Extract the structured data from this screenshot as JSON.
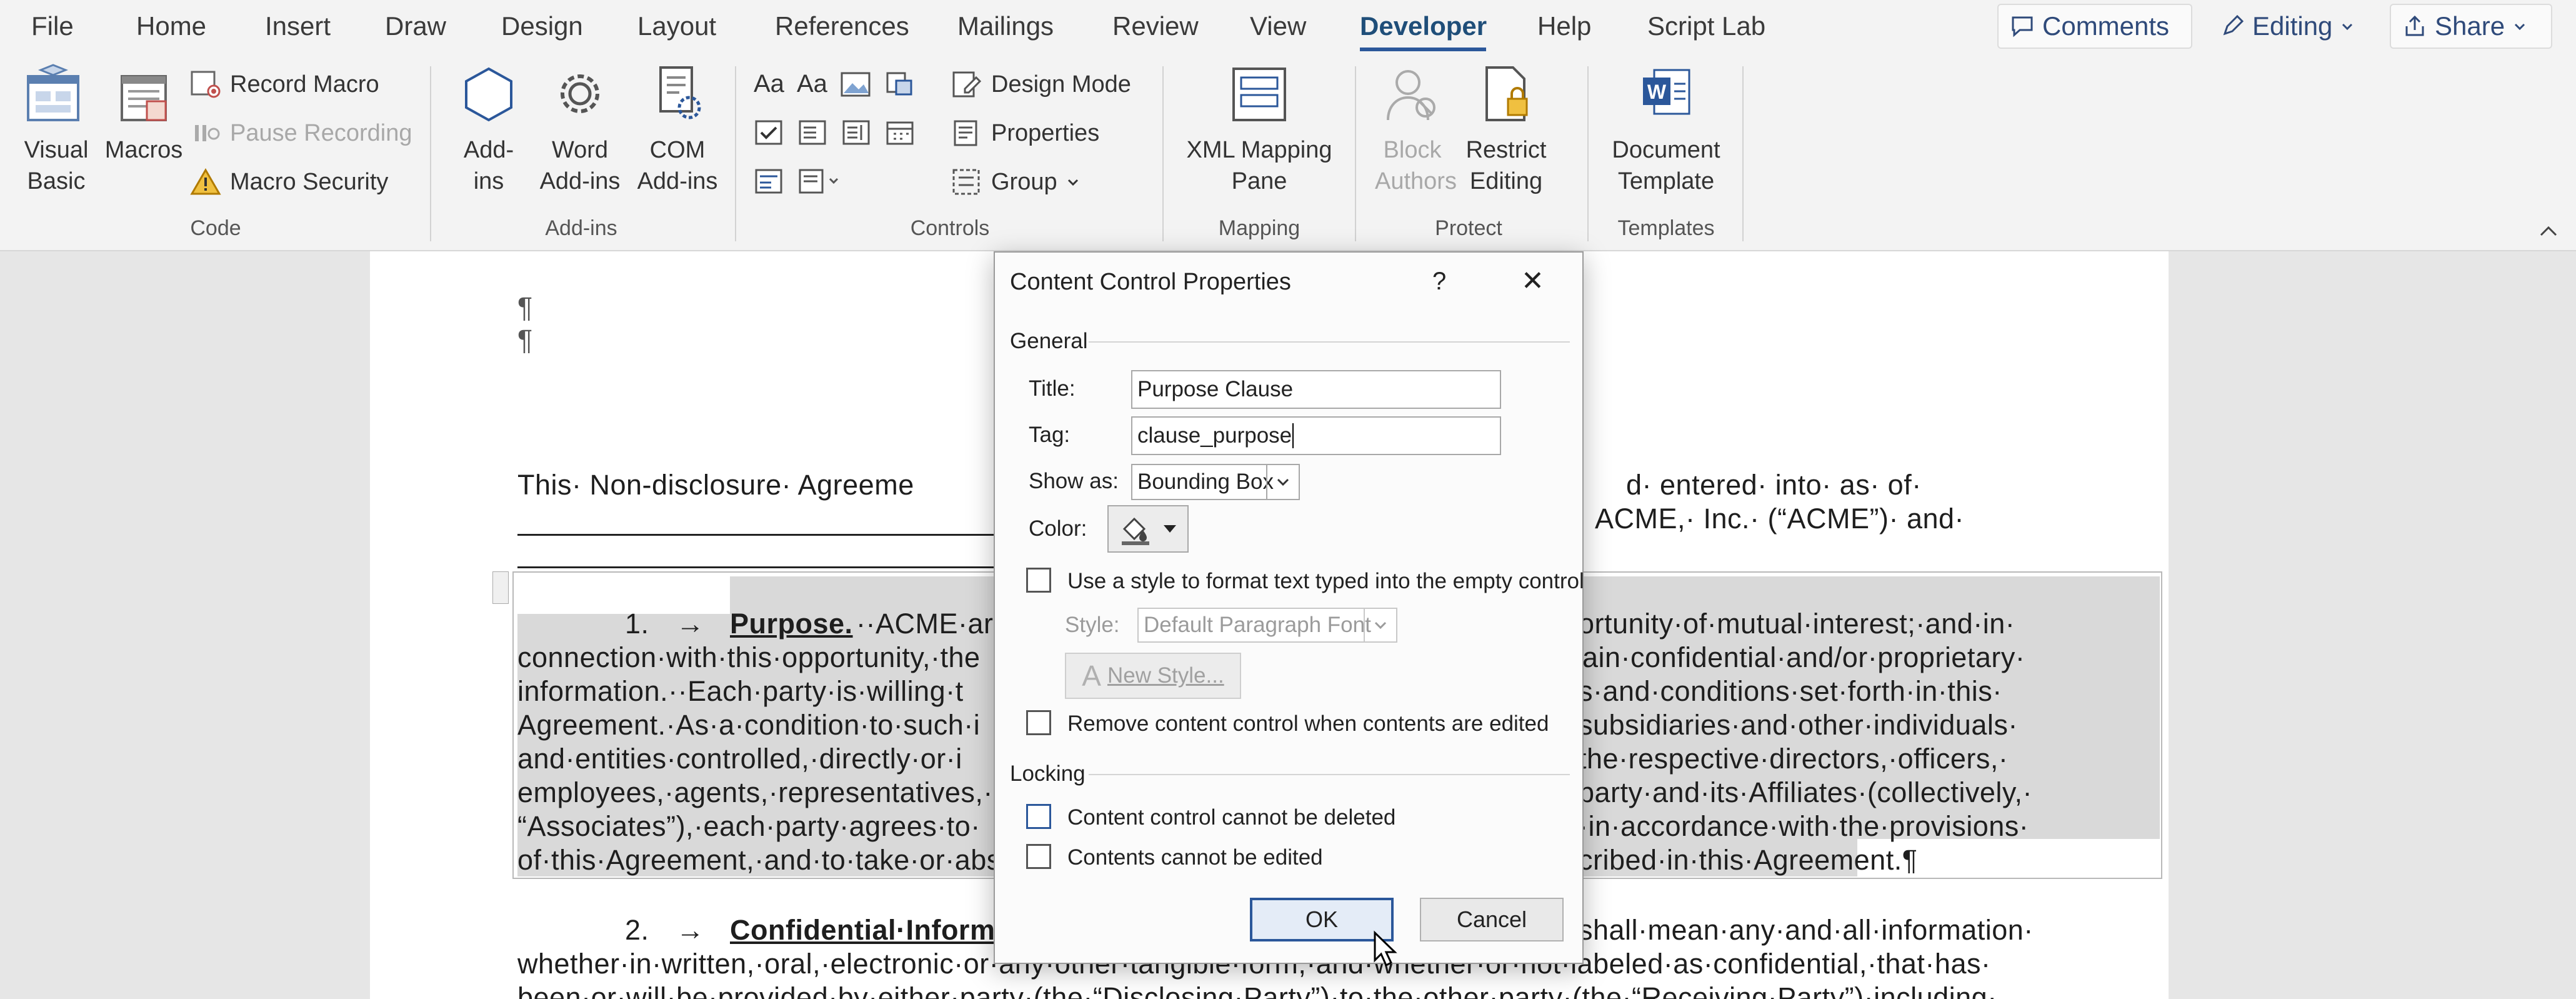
{
  "menubar": {
    "tabs": [
      "File",
      "Home",
      "Insert",
      "Draw",
      "Design",
      "Layout",
      "References",
      "Mailings",
      "Review",
      "View",
      "Developer",
      "Help",
      "Script Lab"
    ],
    "active_tab": "Developer",
    "comments_label": "Comments",
    "editing_label": "Editing",
    "share_label": "Share"
  },
  "ribbon": {
    "code": {
      "visual_basic": "Visual Basic",
      "macros": "Macros",
      "record_macro": "Record Macro",
      "pause_recording": "Pause Recording",
      "macro_security": "Macro Security",
      "group": "Code"
    },
    "addins": {
      "addins": "Add-ins",
      "word_addins": "Word Add-ins",
      "com_addins": "COM Add-ins",
      "group": "Add-ins"
    },
    "controls": {
      "design_mode": "Design Mode",
      "properties": "Properties",
      "group_btn": "Group",
      "group": "Controls"
    },
    "mapping": {
      "xml_mapping_pane": "XML Mapping Pane",
      "group": "Mapping"
    },
    "protect": {
      "block_authors": "Block Authors",
      "restrict_editing": "Restrict Editing",
      "group": "Protect"
    },
    "templates": {
      "document_template": "Document Template",
      "group": "Templates"
    }
  },
  "document": {
    "pilcrow1": "¶",
    "pilcrow2": "¶",
    "intro_line1": "This· Non-disclosure· Agreeme",
    "intro_line1_right": "d· entered· into· as· of·",
    "intro_line2_right": "ACME,· Inc.· (“ACME”)· and·",
    "p1_number": "1.",
    "p1_arrow": "→",
    "p1_heading": "Purpose.",
    "p1_line1_left": "··ACME·ar",
    "p1_line1_right": "ortunity·of·mutual·interest;·and·in·",
    "p1_line2_left": "connection·with·this·opportunity,·the",
    "p1_line2_right": "ain·confidential·and/or·proprietary·",
    "p1_line3_left": "information.··Each·party·is·willing·t",
    "p1_line3_right": "s·and·conditions·set·forth·in·this·",
    "p1_line4_left": "Agreement.·As·a·condition·to·such·i",
    "p1_line4_right": "subsidiaries·and·other·individuals·",
    "p1_line5_left": "and·entities·controlled,·directly·or·i",
    "p1_line5_right": "the·respective·directors,·officers,·",
    "p1_line6_left": "employees,·agents,·representatives,·",
    "p1_line6_right": "party·and·its·Affiliates·(collectively,·",
    "p1_line7_left": "“Associates”),·each·party·agrees·to·",
    "p1_line7_right": "·in·accordance·with·the·provisions·",
    "p1_line8_left": "of·this·Agreement,·and·to·take·or·abs",
    "p1_line8_right": "cribed·in·this·Agreement.¶",
    "p2_number": "2.",
    "p2_arrow": "→",
    "p2_heading": "Confidential·Inform",
    "p2_line1_right": "shall·mean·any·and·all·information·",
    "p2_line2": "whether·in·written,·oral,·electronic·or·any·other·tangible·form,·and·whether·or·not·labeled·as·confidential,·that·has·",
    "p2_line3": "been·or·will·be·provided·by·either·party·(the·“Disclosing·Party”)·to·the·other·party·(the·“Receiving·Party”)·including·"
  },
  "dialog": {
    "title": "Content Control Properties",
    "help": "?",
    "close": "✕",
    "general_heading": "General",
    "title_label": "Title:",
    "title_value": "Purpose Clause",
    "tag_label": "Tag:",
    "tag_value": "clause_purpose",
    "show_as_label": "Show as:",
    "show_as_value": "Bounding Box",
    "color_label": "Color:",
    "use_style_label": "Use a style to format text typed into the empty control",
    "style_label": "Style:",
    "style_value": "Default Paragraph Font",
    "new_style_label": "New Style...",
    "remove_label": "Remove content control when contents are edited",
    "locking_heading": "Locking",
    "cannot_delete_label": "Content control cannot be deleted",
    "cannot_edit_label": "Contents cannot be edited",
    "ok_label": "OK",
    "cancel_label": "Cancel"
  },
  "colors": {
    "accent": "#2b579a",
    "selection_shade": "#d9d9d9",
    "dialog_bg": "#fbfbfb"
  }
}
